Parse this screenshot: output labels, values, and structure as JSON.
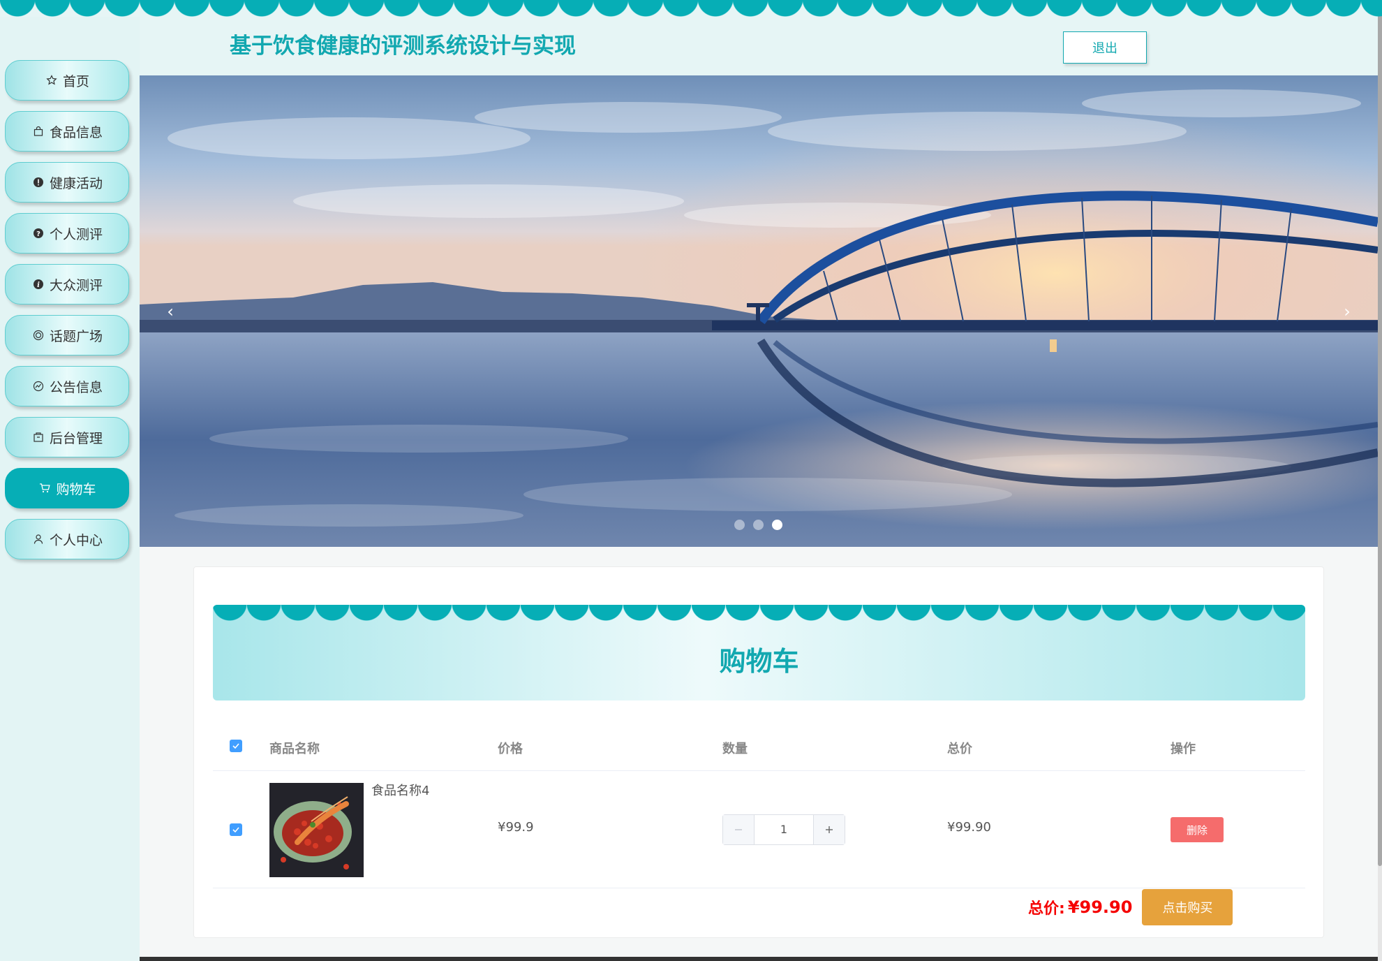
{
  "header": {
    "title": "基于饮食健康的评测系统设计与实现",
    "logout_label": "退出"
  },
  "sidebar": {
    "items": [
      {
        "label": "首页",
        "icon": "star-icon"
      },
      {
        "label": "食品信息",
        "icon": "shopping-bag-icon"
      },
      {
        "label": "健康活动",
        "icon": "warning-circle-icon"
      },
      {
        "label": "个人测评",
        "icon": "question-circle-icon"
      },
      {
        "label": "大众测评",
        "icon": "info-circle-icon"
      },
      {
        "label": "话题广场",
        "icon": "target-icon"
      },
      {
        "label": "公告信息",
        "icon": "chart-circle-icon"
      },
      {
        "label": "后台管理",
        "icon": "box-icon"
      },
      {
        "label": "购物车",
        "icon": "cart-icon",
        "active": true
      },
      {
        "label": "个人中心",
        "icon": "user-icon"
      }
    ]
  },
  "carousel": {
    "prev_icon": "‹",
    "next_icon": "›",
    "slide_count": 3,
    "active_index": 2
  },
  "cart": {
    "title": "购物车",
    "columns": {
      "name": "商品名称",
      "price": "价格",
      "quantity": "数量",
      "total": "总价",
      "action": "操作"
    },
    "items": [
      {
        "name": "食品名称4",
        "price": "¥99.9",
        "quantity": "1",
        "subtotal": "¥99.90",
        "delete_label": "删除",
        "checked": true
      }
    ],
    "total_label": "总价:",
    "total_value": "¥99.90",
    "buy_label": "点击购买"
  },
  "colors": {
    "accent": "#06aeb6",
    "danger": "#f56c6c",
    "warning": "#e6a23c",
    "total_red": "#f50000"
  }
}
